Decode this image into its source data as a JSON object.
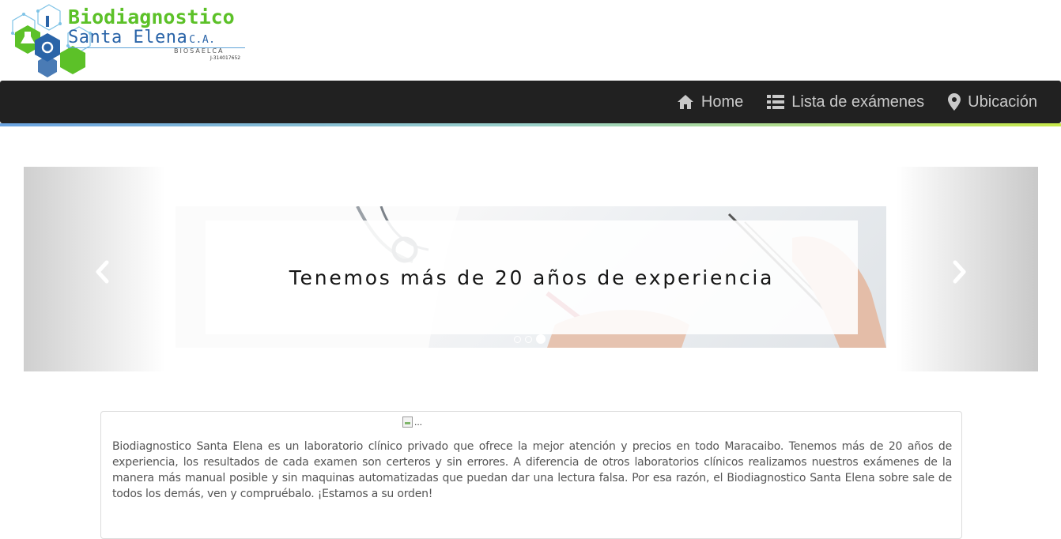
{
  "brand": {
    "title": "Biodiagnostico",
    "subtitle": "Santa Elena",
    "suffix": "C.A.",
    "short_name": "BIOSAELCA",
    "rif": "J-314017652"
  },
  "nav": {
    "items": [
      {
        "label": "Home",
        "icon": "home-icon"
      },
      {
        "label": "Lista de exámenes",
        "icon": "list-icon"
      },
      {
        "label": "Ubicación",
        "icon": "map-marker-icon"
      }
    ]
  },
  "carousel": {
    "caption": "Tenemos más de 20 años de experiencia",
    "slide_count": 3,
    "active_index": 2
  },
  "about": {
    "image_alt": "...",
    "text": "Biodiagnostico Santa Elena es un laboratorio clínico privado que ofrece la mejor atención y precios en todo Maracaibo. Tenemos más de 20 años de experiencia, los resultados de cada examen son certeros y sin errores. A diferencia de otros laboratorios clínicos realizamos nuestros exámenes de la manera más manual posible y sin maquinas automatizadas que puedan dar una lectura falsa. Por esa razón, el Biodiagnostico Santa Elena sobre sale de todos los demás, ven y compruébalo. ¡Estamos a su orden!"
  },
  "colors": {
    "brand_green": "#5cc128",
    "brand_blue": "#2a64a8",
    "navbar_bg": "#212121",
    "nav_text": "#c9c9c9"
  }
}
